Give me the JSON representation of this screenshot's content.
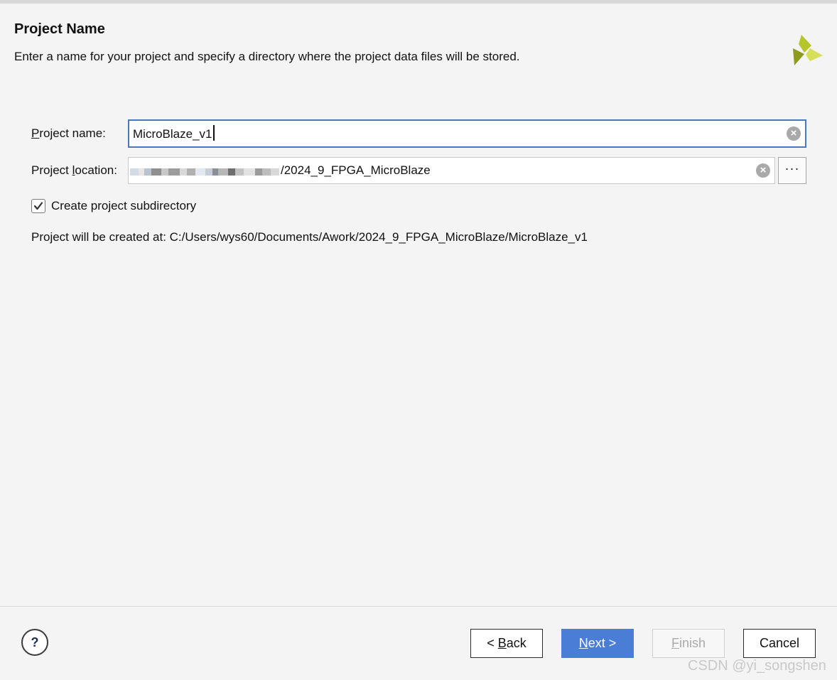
{
  "header": {
    "title": "Project Name",
    "subtitle": "Enter a name for your project and specify a directory where the project data files will be stored."
  },
  "logo": {
    "icon": "xilinx-logo-icon",
    "colors": [
      "#b5c52a",
      "#8e9a1c",
      "#d6df58"
    ]
  },
  "form": {
    "name_label_prefix": "",
    "name_label_mnemonic": "P",
    "name_label_rest": "roject name:",
    "name_value": "MicroBlaze_v1",
    "location_label_prefix": "Project ",
    "location_label_mnemonic": "l",
    "location_label_rest": "ocation:",
    "location_value_suffix": "/2024_9_FPGA_MicroBlaze",
    "browse_label": "···",
    "checkbox_label": "Create project subdirectory",
    "checkbox_checked": true,
    "created_at": "Project will be created at: C:/Users/wys60/Documents/Awork/2024_9_FPGA_MicroBlaze/MicroBlaze_v1"
  },
  "footer": {
    "help_label": "?",
    "back_prefix": "< ",
    "back_mnemonic": "B",
    "back_rest": "ack",
    "next_mnemonic": "N",
    "next_rest": "ext >",
    "finish_mnemonic": "F",
    "finish_rest": "inish",
    "cancel_label": "Cancel"
  },
  "watermark": "CSDN @yi_songshen",
  "colors": {
    "accent": "#4a7ed6",
    "focus_border": "#4a78c2"
  }
}
